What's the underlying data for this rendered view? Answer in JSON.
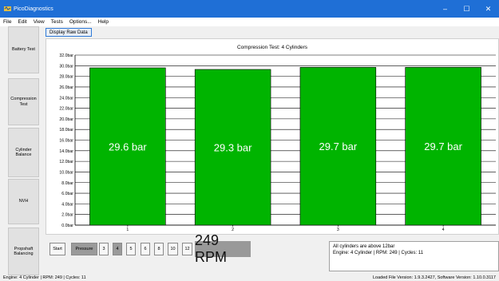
{
  "window": {
    "title": "PicoDiagnostics",
    "controls": {
      "minimize": "–",
      "maximize": "☐",
      "close": "✕"
    }
  },
  "menu": [
    "File",
    "Edit",
    "View",
    "Tests",
    "Options...",
    "Help"
  ],
  "toolbar": {
    "display_raw_label": "Display Raw Data"
  },
  "sidebar": {
    "items": [
      {
        "label": "Battery Test"
      },
      {
        "label": "Compression Test"
      },
      {
        "label": "Cylinder Balance"
      },
      {
        "label": "NVH"
      },
      {
        "label": "Propshaft Balancing"
      }
    ]
  },
  "chart_data": {
    "type": "bar",
    "title": "Compression Test: 4 Cylinders",
    "categories": [
      "1",
      "2",
      "3",
      "4"
    ],
    "values": [
      29.6,
      29.3,
      29.7,
      29.7
    ],
    "data_labels": [
      "29.6 bar",
      "29.3 bar",
      "29.7 bar",
      "29.7 bar"
    ],
    "unit": "bar",
    "ylim": [
      0,
      32
    ],
    "yticks": [
      "0.0bar",
      "2.0bar",
      "4.0bar",
      "6.0bar",
      "8.0bar",
      "10.0bar",
      "12.0bar",
      "14.0bar",
      "16.0bar",
      "18.0bar",
      "20.0bar",
      "22.0bar",
      "24.0bar",
      "26.0bar",
      "28.0bar",
      "30.0bar",
      "32.0bar"
    ],
    "bar_color": "#00b400",
    "grid": true
  },
  "controls": {
    "start_label": "Start",
    "pressure_label": "Pressure",
    "cylinder_options": [
      "3",
      "4",
      "5",
      "6",
      "8",
      "10",
      "12"
    ],
    "selected_cylinders": "4",
    "rpm_display": "249 RPM"
  },
  "messages": {
    "line1": "All cylinders are above 12bar",
    "line2": "Engine: 4 Cylinder | RPM: 249 | Cycles: 11"
  },
  "status": {
    "left": "Engine: 4 Cylinder | RPM: 249 | Cycles: 11",
    "right": "Loaded File Version: 1.9.3.2427,  Software Version: 1.10.0.3117"
  },
  "colors": {
    "titlebar": "#1f6fd6",
    "bar": "#00b400",
    "accent": "#2f7ad8"
  }
}
